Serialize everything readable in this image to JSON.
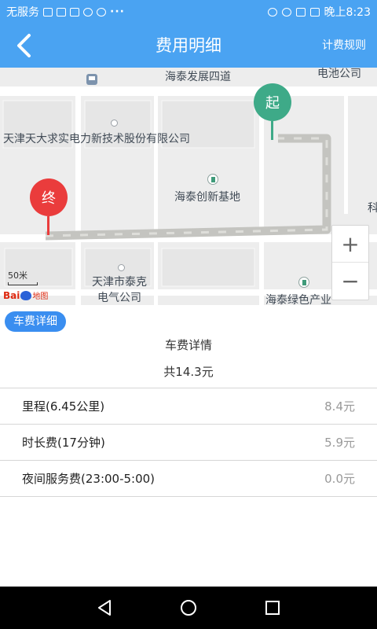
{
  "status_bar": {
    "carrier": "无服务",
    "time": "晚上8:23",
    "dots": "···"
  },
  "header": {
    "title": "费用明细",
    "rules_link": "计费规则"
  },
  "map": {
    "labels": {
      "road_top": "海泰发展四道",
      "company_top_right": "电池公司",
      "company_long": "天津天大求实电力新技术股份有限公司",
      "innovation_base": "海泰创新基地",
      "taike_line1": "天津市泰克",
      "taike_line2": "电气公司",
      "green_industry": "海泰绿色产业",
      "edge_char": "科"
    },
    "start_marker": "起",
    "end_marker": "终",
    "scale_label": "50米",
    "logo_text": "Bai",
    "logo_suffix": "地图",
    "route_color": "#c4c4c0",
    "zoom_in": "+",
    "zoom_out": "−"
  },
  "fare": {
    "tag": "车费详细",
    "section_title": "车费详情",
    "total": "共14.3元",
    "items": [
      {
        "label": "里程(6.45公里)",
        "value": "8.4元"
      },
      {
        "label": "时长费(17分钟)",
        "value": "5.9元"
      },
      {
        "label": "夜间服务费(23:00-5:00)",
        "value": "0.0元"
      }
    ]
  },
  "colors": {
    "primary": "#4aa3f2",
    "tag_blue": "#3a8ef0",
    "start_green": "#3eaa88",
    "end_red": "#ea3c3c"
  },
  "icons": {
    "back": "chevron-left-icon",
    "nav_back": "triangle-back-icon",
    "nav_home": "circle-home-icon",
    "nav_recent": "square-recent-icon"
  }
}
